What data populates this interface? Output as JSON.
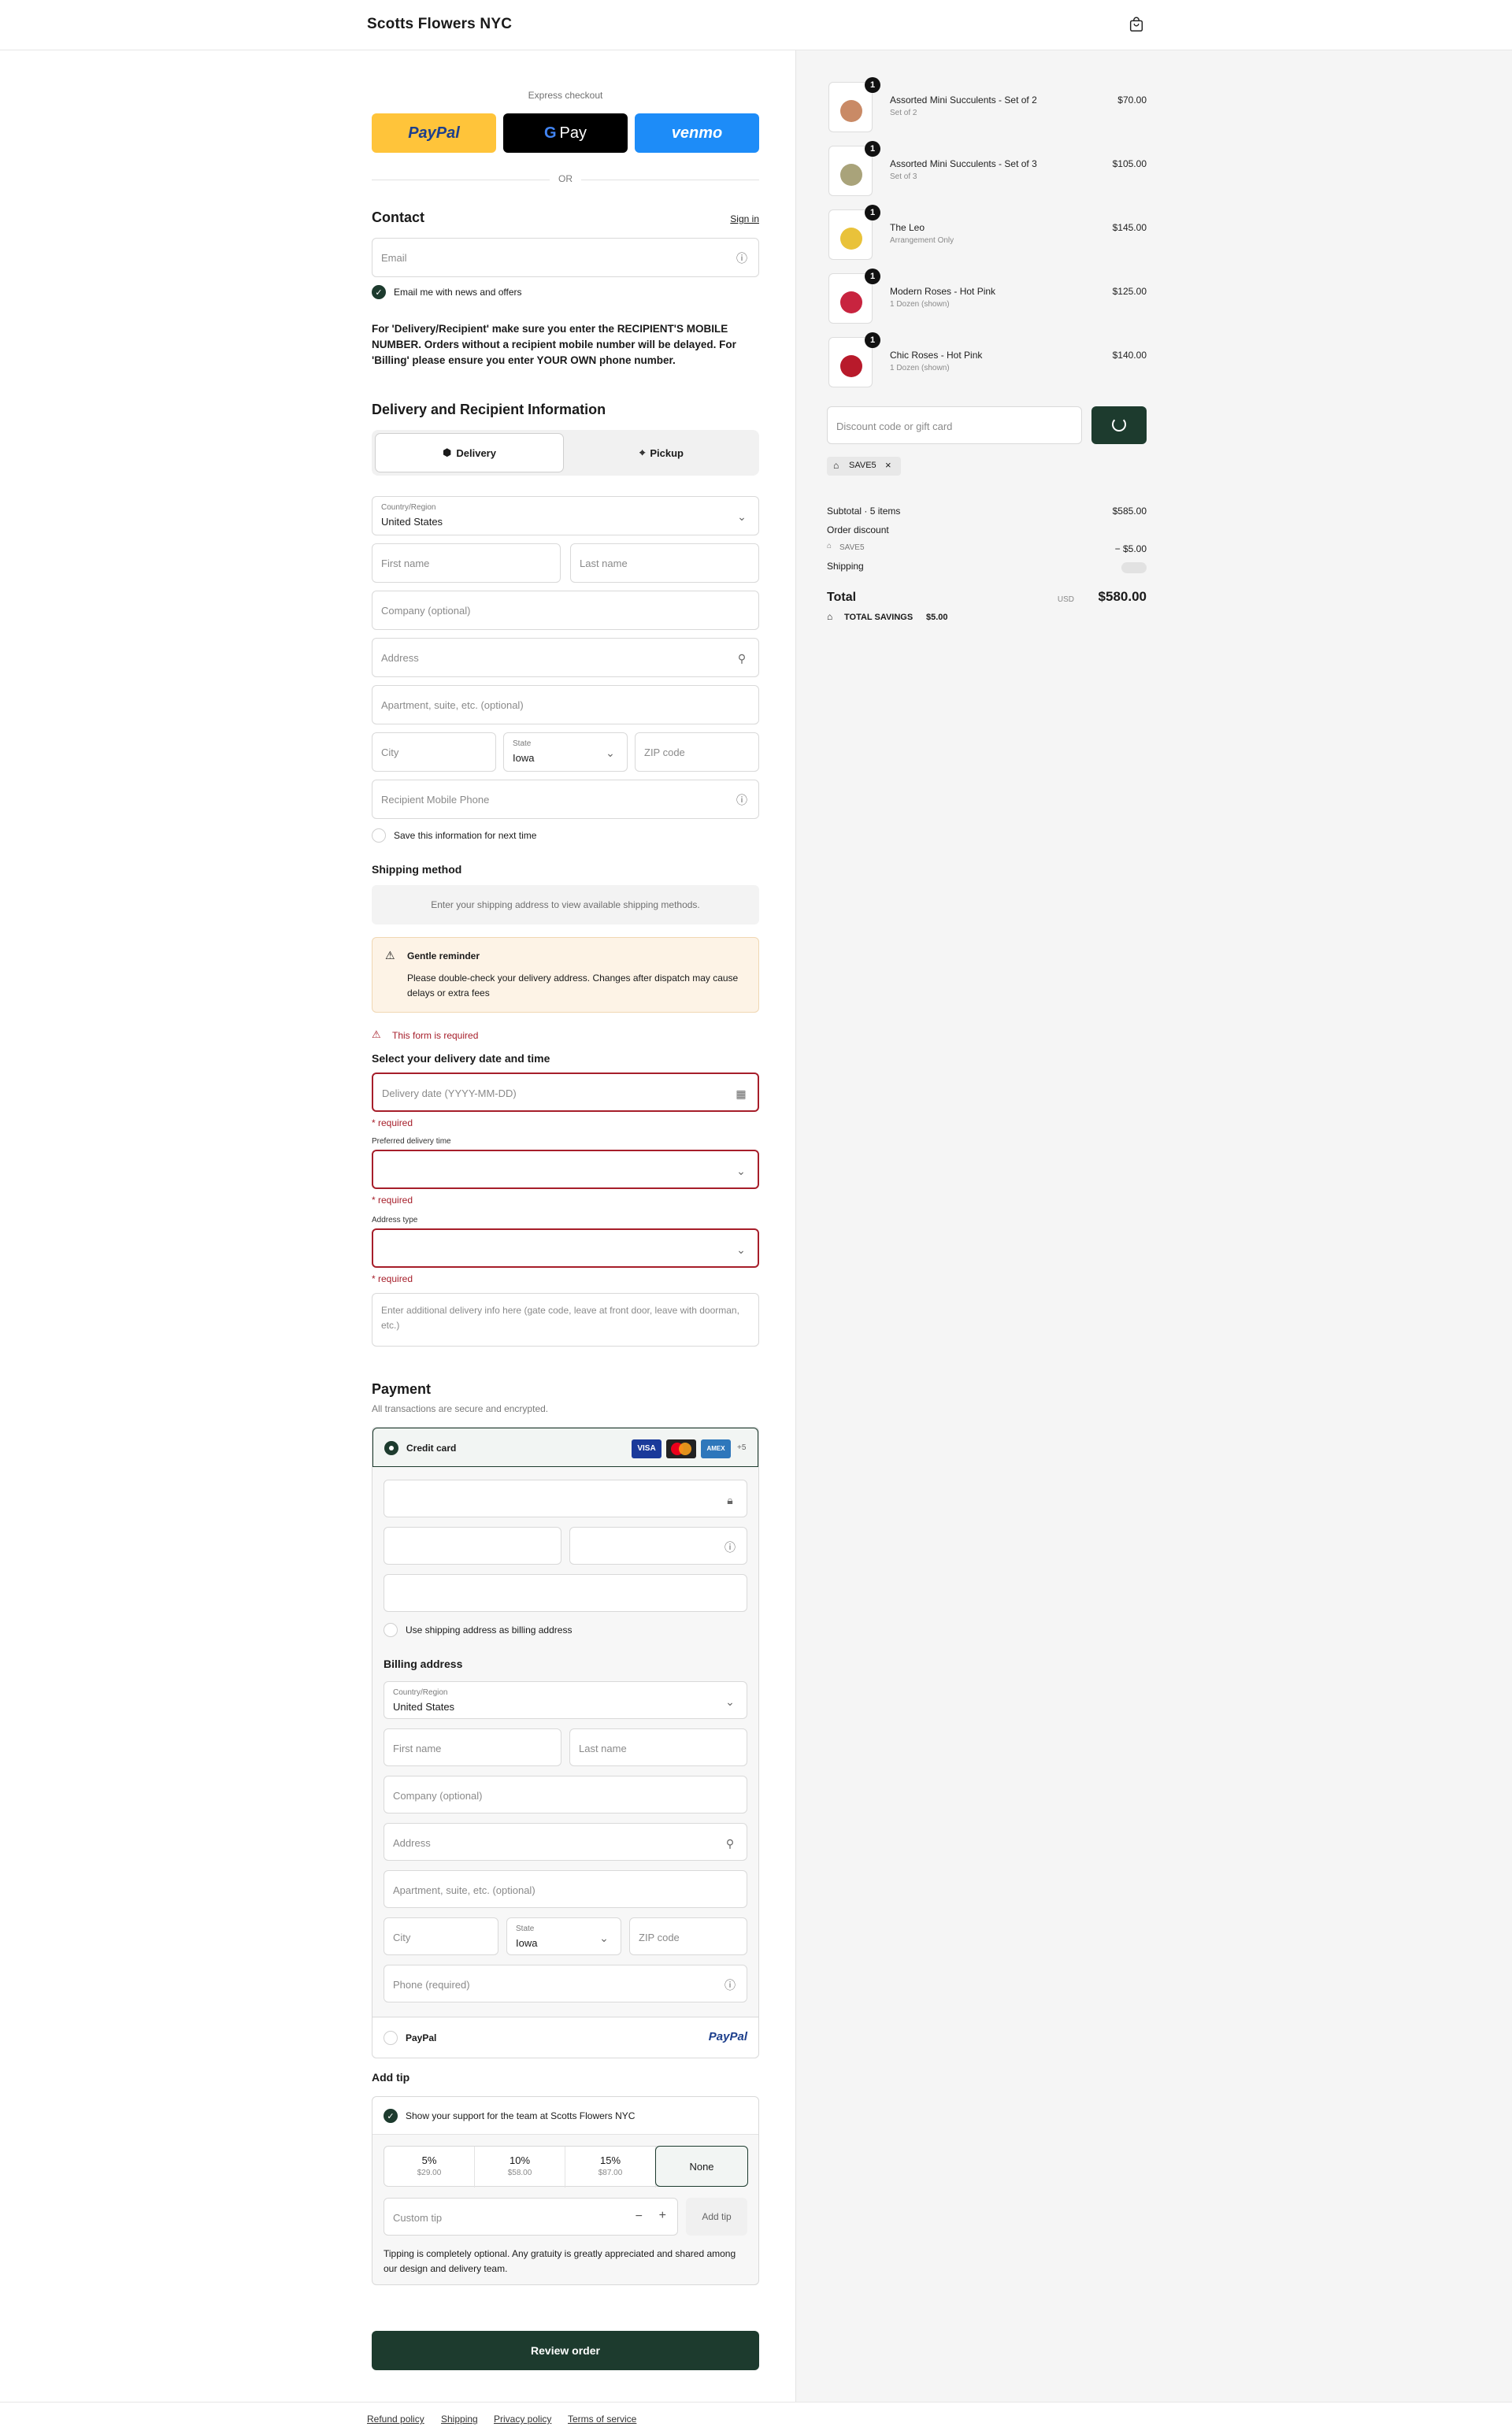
{
  "header": {
    "brand": "Scotts Flowers NYC",
    "cart_icon": "shopping-bag-icon"
  },
  "express": {
    "label": "Express checkout",
    "paypal": "PayPal",
    "gpay": "Pay",
    "venmo": "venmo",
    "or": "OR"
  },
  "contact": {
    "title": "Contact",
    "sign_in": "Sign in",
    "email_placeholder": "Email",
    "news_label": "Email me with news and offers",
    "notice": "For 'Delivery/Recipient' make sure you enter the RECIPIENT'S MOBILE NUMBER. Orders without a recipient mobile number will be delayed. For 'Billing' please ensure you enter YOUR OWN phone number."
  },
  "delivery": {
    "title": "Delivery and Recipient Information",
    "tab_delivery": "Delivery",
    "tab_pickup": "Pickup",
    "country_label": "Country/Region",
    "country_value": "United States",
    "first_name": "First name",
    "last_name": "Last name",
    "company": "Company (optional)",
    "address": "Address",
    "apartment": "Apartment, suite, etc. (optional)",
    "city": "City",
    "state_label": "State",
    "state_value": "Iowa",
    "zip": "ZIP code",
    "phone": "Recipient Mobile Phone",
    "save_info": "Save this information for next time"
  },
  "shipping": {
    "title": "Shipping method",
    "info": "Enter your shipping address to view available shipping methods.",
    "reminder_title": "Gentle reminder",
    "reminder_text": "Please double-check your delivery address. Changes after dispatch may cause delays or extra fees",
    "form_required": "This form is required",
    "date_title": "Select your delivery date and time",
    "date_placeholder": "Delivery date (YYYY-MM-DD)",
    "required": "* required",
    "time_label": "Preferred delivery time",
    "address_type_label": "Address type",
    "instructions_placeholder": "Enter additional delivery info here (gate code, leave at front door, leave with doorman, etc.)"
  },
  "payment": {
    "title": "Payment",
    "subtitle": "All transactions are secure and encrypted.",
    "credit_card": "Credit card",
    "card_brands": [
      "VISA",
      "MC",
      "AMEX"
    ],
    "more_cards": "+5",
    "use_shipping": "Use shipping address as billing address",
    "billing_title": "Billing address",
    "country_label": "Country/Region",
    "country_value": "United States",
    "first_name": "First name",
    "last_name": "Last name",
    "company": "Company (optional)",
    "address": "Address",
    "apartment": "Apartment, suite, etc. (optional)",
    "city": "City",
    "state_label": "State",
    "state_value": "Iowa",
    "zip": "ZIP code",
    "phone": "Phone (required)",
    "paypal": "PayPal",
    "paypal_logo": "PayPal"
  },
  "tip": {
    "title": "Add tip",
    "support": "Show your support for the team at Scotts Flowers NYC",
    "options": [
      {
        "pct": "5%",
        "amt": "$29.00"
      },
      {
        "pct": "10%",
        "amt": "$58.00"
      },
      {
        "pct": "15%",
        "amt": "$87.00"
      }
    ],
    "none": "None",
    "custom_placeholder": "Custom tip",
    "minus": "−",
    "plus": "+",
    "add_button": "Add tip",
    "note": "Tipping is completely optional. Any gratuity is greatly appreciated and shared among our design and delivery team."
  },
  "review_button": "Review order",
  "summary": {
    "items": [
      {
        "qty": "1",
        "name": "Assorted Mini Succulents - Set of 2",
        "variant": "Set of 2",
        "price": "$70.00",
        "color": "#c98a66"
      },
      {
        "qty": "1",
        "name": "Assorted Mini Succulents - Set of 3",
        "variant": "Set of 3",
        "price": "$105.00",
        "color": "#a9a37a"
      },
      {
        "qty": "1",
        "name": "The Leo",
        "variant": "Arrangement Only",
        "price": "$145.00",
        "color": "#e9c23a"
      },
      {
        "qty": "1",
        "name": "Modern Roses - Hot Pink",
        "variant": "1 Dozen (shown)",
        "price": "$125.00",
        "color": "#c8243f"
      },
      {
        "qty": "1",
        "name": "Chic Roses - Hot Pink",
        "variant": "1 Dozen (shown)",
        "price": "$140.00",
        "color": "#b81a2b"
      }
    ],
    "discount_placeholder": "Discount code or gift card",
    "code": "SAVE5",
    "subtotal_label": "Subtotal · 5 items",
    "subtotal": "$585.00",
    "order_discount": "Order discount",
    "discount_code": "SAVE5",
    "discount_amount": "− $5.00",
    "shipping_label": "Shipping",
    "total_label": "Total",
    "currency": "USD",
    "total": "$580.00",
    "savings_label": "TOTAL SAVINGS",
    "savings": "$5.00"
  },
  "footer": {
    "refund": "Refund policy",
    "shipping": "Shipping",
    "privacy": "Privacy policy",
    "terms": "Terms of service"
  }
}
